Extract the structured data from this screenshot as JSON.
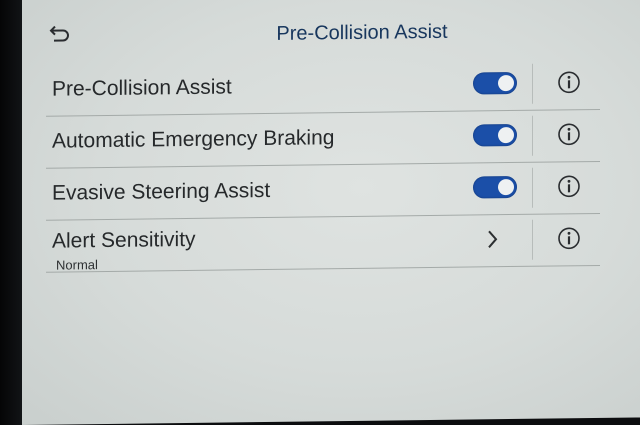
{
  "header": {
    "title": "Pre-Collision Assist"
  },
  "settings": [
    {
      "label": "Pre-Collision Assist",
      "toggle_on": true
    },
    {
      "label": "Automatic Emergency Braking",
      "toggle_on": true
    },
    {
      "label": "Evasive Steering Assist",
      "toggle_on": true
    },
    {
      "label": "Alert Sensitivity",
      "value": "Normal"
    }
  ],
  "icons": {
    "back": "back-arrow-icon",
    "info": "info-icon",
    "chevron": "chevron-right-icon"
  },
  "colors": {
    "title": "#17365d",
    "toggle_on": "#1b4fa8",
    "screen_bg": "#d9dedc"
  }
}
